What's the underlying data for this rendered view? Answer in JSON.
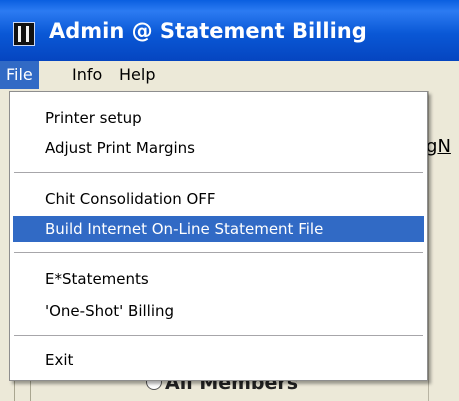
{
  "window": {
    "title": "Admin @ Statement Billing"
  },
  "menubar": {
    "items": [
      "File",
      "Info",
      "Help"
    ]
  },
  "file_menu": {
    "items": [
      "Printer setup",
      "Adjust Print Margins",
      "Chit Consolidation OFF",
      "Build Internet On-Line Statement File",
      "E*Statements",
      "'One-Shot' Billing",
      "Exit"
    ],
    "highlighted": "Build Internet On-Line Statement File"
  },
  "background": {
    "peek_text": "g",
    "peek_text_underlined": "N",
    "radio_label": "All Members"
  },
  "colors": {
    "titlebar": "#0a58d6",
    "highlight": "#316ac5",
    "chrome": "#ece9d8"
  }
}
